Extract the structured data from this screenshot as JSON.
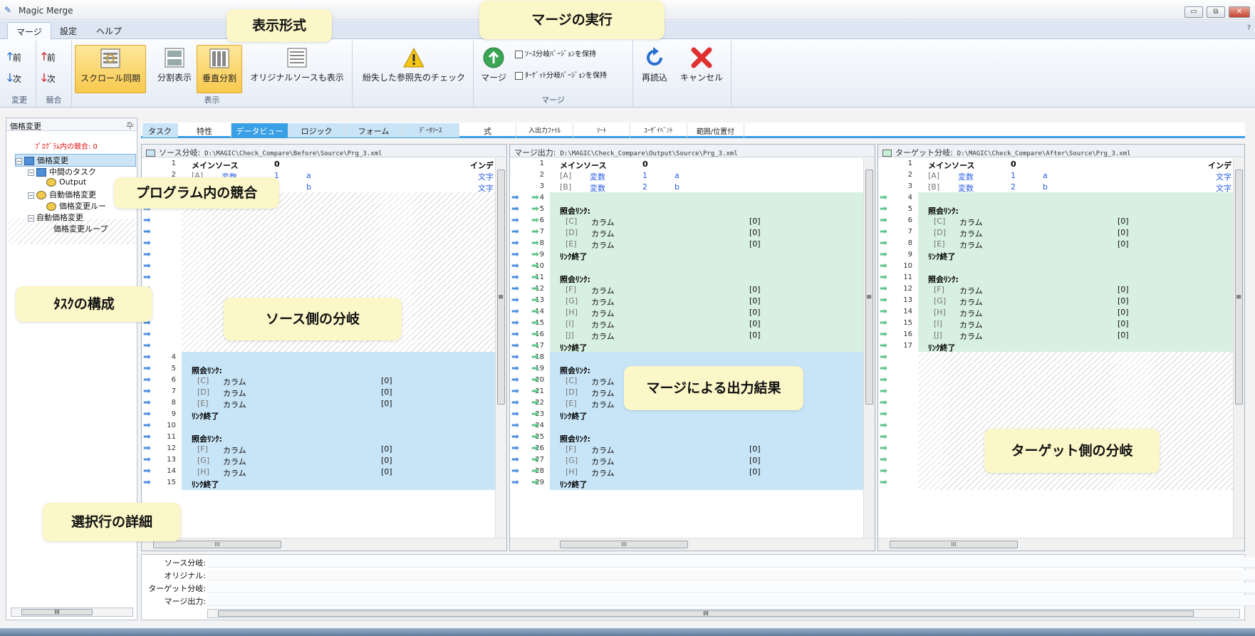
{
  "window": {
    "title": "Magic Merge",
    "min": "▭",
    "max": "⧉",
    "close": "✕"
  },
  "menu": {
    "tabs": [
      "マージ",
      "設定",
      "ヘルプ"
    ],
    "help_caret": "?"
  },
  "ribbon": {
    "change": {
      "prev": "前",
      "next": "次",
      "label": "変更"
    },
    "conflict": {
      "prev": "前",
      "next": "次",
      "label": "競合"
    },
    "display": {
      "scroll_sync": "スクロール同期",
      "split": "分割表示",
      "vertical": "垂直分割",
      "original": "オリジナルソースも表示",
      "label": "表示"
    },
    "missing_refs": "紛失した参照先のチェック",
    "merge": {
      "run": "マージ",
      "keep_source": "ｿｰｽ分岐ﾊﾞｰｼﾞｮﾝを保持",
      "keep_target": "ﾀｰｹﾞｯﾄ分岐ﾊﾞｰｼﾞｮﾝを保持",
      "label": "マージ"
    },
    "reload": "再読込",
    "cancel": "キャンセル"
  },
  "left": {
    "title": "価格変更",
    "pin": "卆",
    "conflicts": "ﾌﾟﾛｸﾞﾗﾑ内の競合: 0",
    "tree": [
      "価格変更",
      "中間のタスク",
      "Output",
      "自動価格変更",
      "価格変更ルー",
      "自動価格変更",
      "価格変更ループ"
    ],
    "scroll_thumb": "III"
  },
  "tabs": [
    "タスク",
    "特性",
    "データビュー",
    "ロジック",
    "フォーム",
    "ﾃﾞｰﾀｿｰｽ",
    "式",
    "入出力ﾌｧｲﾙ",
    "ｿｰﾄ",
    "ﾕｰｻﾞｲﾍﾞﾝﾄ",
    "範囲/位置付"
  ],
  "panes": {
    "source": {
      "label": "ソース分岐:",
      "path": "D:\\MAGIC\\Check_Compare\\Before\\Source\\Prg_3.xml",
      "color": "#c8e5f8"
    },
    "output": {
      "label": "マージ出力:",
      "path": "D:\\MAGIC\\Check_Compare\\Output\\Source\\Prg_3.xml",
      "color": "#ffffff"
    },
    "target": {
      "label": "ターゲット分岐:",
      "path": "D:\\MAGIC\\Check_Compare\\After\\Source\\Prg_3.xml",
      "color": "#c8f0d6"
    }
  },
  "code": {
    "main_source": "メインソース",
    "zero": "0",
    "index": "インデ",
    "var": "変数",
    "text": "文字",
    "a": "a",
    "b": "b",
    "one": "1",
    "two": "2",
    "lookup": "照会ﾘﾝｸ:",
    "column": "カラム",
    "idx0": "[0]",
    "end": "ﾘﾝｸ終了"
  },
  "details": {
    "labels": [
      "ソース分岐:",
      "オリジナル:",
      "ターゲット分岐:",
      "マージ出力:"
    ]
  },
  "callouts": {
    "display_format": "表示形式",
    "merge_exec": "マージの実行",
    "program_conflict": "プログラム内の競合",
    "task_structure": "ﾀｽｸの構成",
    "source_branch": "ソース側の分岐",
    "merge_result": "マージによる出力結果",
    "target_branch": "ターゲット側の分岐",
    "row_details": "選択行の詳細"
  },
  "scroll_grip": "III",
  "vgrip": "≡"
}
